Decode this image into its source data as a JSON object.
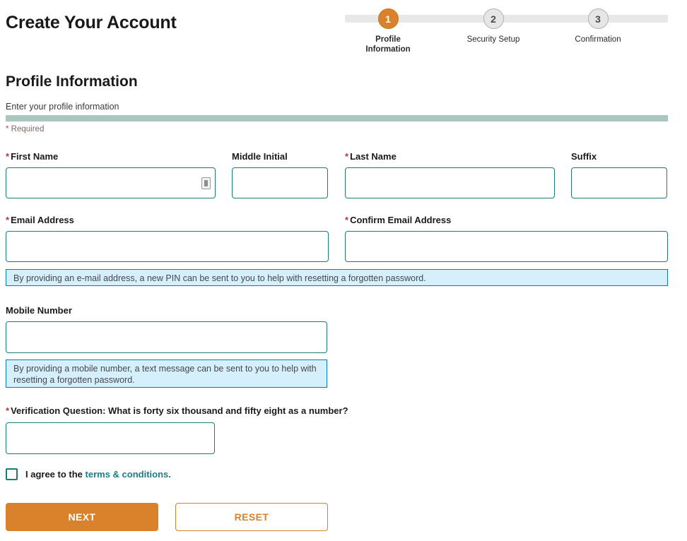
{
  "header": {
    "title": "Create Your Account"
  },
  "stepper": {
    "steps": [
      {
        "number": "1",
        "label": "Profile\nInformation",
        "state": "active"
      },
      {
        "number": "2",
        "label": "Security Setup",
        "state": "inactive"
      },
      {
        "number": "3",
        "label": "Confirmation",
        "state": "inactive"
      }
    ],
    "active_color": "#d9822b",
    "inactive_color": "#e6e6e6",
    "track_color": "#e8e8e8"
  },
  "section": {
    "title": "Profile Information",
    "subtitle": "Enter your profile information",
    "divider_color": "#a9c6bf",
    "required_note": "* Required",
    "required_star": "*"
  },
  "fields": {
    "first_name": {
      "label": "First Name",
      "required": true,
      "value": "",
      "placeholder": ""
    },
    "middle_initial": {
      "label": "Middle Initial",
      "required": false,
      "value": "",
      "placeholder": ""
    },
    "last_name": {
      "label": "Last Name",
      "required": true,
      "value": "",
      "placeholder": ""
    },
    "suffix": {
      "label": "Suffix",
      "required": false,
      "value": "",
      "placeholder": ""
    },
    "email": {
      "label": "Email Address",
      "required": true,
      "value": "",
      "placeholder": ""
    },
    "confirm_email": {
      "label": "Confirm Email Address",
      "required": true,
      "value": "",
      "placeholder": ""
    },
    "mobile": {
      "label": "Mobile Number",
      "required": false,
      "value": "",
      "placeholder": ""
    },
    "verification": {
      "label": "Verification Question: What is forty six thousand and fifty eight as a number?",
      "required": true,
      "value": "",
      "placeholder": ""
    }
  },
  "info_boxes": {
    "email_hint": "By providing an e-mail address, a new PIN can be sent to you to help with resetting a forgotten password.",
    "mobile_hint": "By providing a mobile number, a text message can be sent to you to help with resetting a forgotten password.",
    "background": "#d6effc",
    "border": "#0a7bb5"
  },
  "agreement": {
    "checked": false,
    "text": "I agree to the ",
    "link_text": "terms & conditions.",
    "link_color": "#1a7d8a"
  },
  "buttons": {
    "next": "NEXT",
    "reset": "RESET",
    "primary_color": "#d9822b"
  },
  "icons": {
    "autofill": "autofill-icon"
  }
}
